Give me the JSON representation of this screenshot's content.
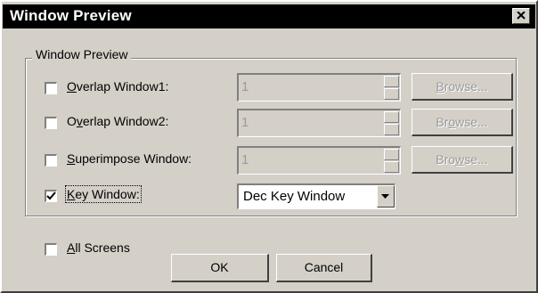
{
  "window": {
    "title": "Window Preview"
  },
  "group": {
    "label": "Window Preview"
  },
  "rows": [
    {
      "checked": false,
      "label_mnemonic": "O",
      "label_rest": "verlap Window1:",
      "value": "1",
      "browse_mnemonic": "B",
      "browse_rest": "rowse..."
    },
    {
      "checked": false,
      "label_pre": "O",
      "label_mnemonic": "v",
      "label_rest": "erlap Window2:",
      "value": "1",
      "browse_pre": "Br",
      "browse_mnemonic": "o",
      "browse_rest": "wse..."
    },
    {
      "checked": false,
      "label_mnemonic": "S",
      "label_rest": "uperimpose Window:",
      "value": "1",
      "browse_pre": "Bro",
      "browse_mnemonic": "w",
      "browse_rest": "se..."
    }
  ],
  "key_window": {
    "checked": true,
    "label_mnemonic": "K",
    "label_rest": "ey Window:",
    "selected": "Dec Key Window"
  },
  "all_screens": {
    "checked": false,
    "label_mnemonic": "A",
    "label_rest": "ll Screens"
  },
  "buttons": {
    "ok": "OK",
    "cancel": "Cancel"
  }
}
